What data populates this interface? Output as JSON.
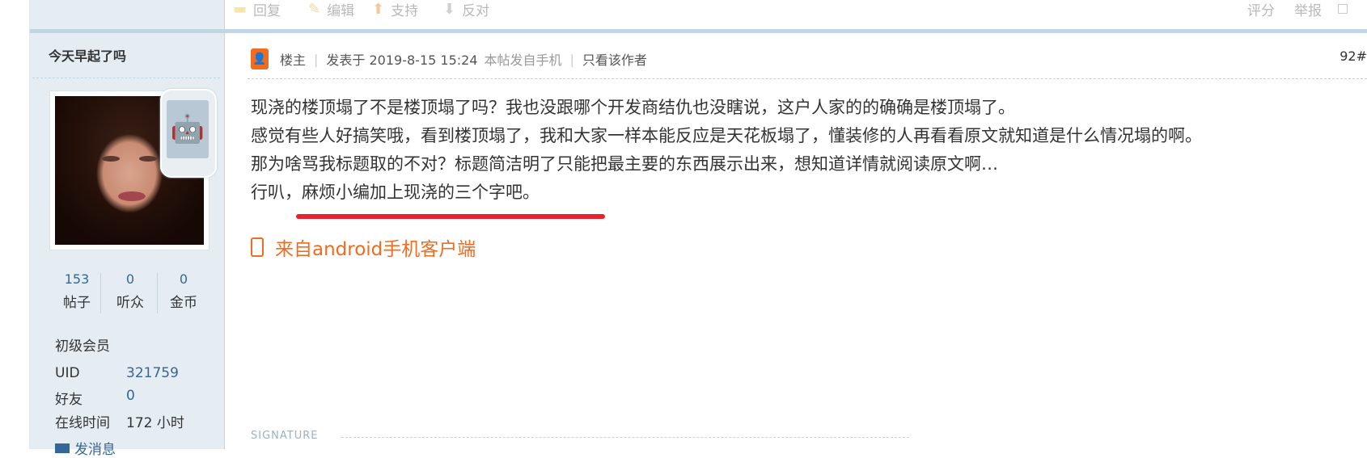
{
  "toolbar": {
    "reply": "回复",
    "edit": "编辑",
    "support": "支持",
    "oppose": "反对",
    "rate": "评分",
    "report": "举报"
  },
  "author": {
    "name": "今天早起了吗",
    "stats": [
      {
        "value": "153",
        "label": "帖子"
      },
      {
        "value": "0",
        "label": "听众"
      },
      {
        "value": "0",
        "label": "金币"
      }
    ],
    "rank": "初级会员",
    "fields": [
      {
        "key": "UID",
        "value": "321759"
      },
      {
        "key": "好友",
        "value": "0"
      },
      {
        "key": "在线时间",
        "value": "172 小时"
      }
    ],
    "send_message": "发消息"
  },
  "post": {
    "owner_label": "楼主",
    "posted_at": "发表于 2019-8-15 15:24",
    "source_note": "本帖发自手机",
    "only_author": "只看该作者",
    "floor_number": "92#",
    "lines": [
      "现浇的楼顶塌了不是楼顶塌了吗？我也没跟哪个开发商结仇也没瞎说，这户人家的的确确是楼顶塌了。",
      "感觉有些人好搞笑哦，看到楼顶塌了，我和大家一样本能反应是天花板塌了，懂装修的人再看看原文就知道是什么情况塌的啊。",
      "那为啥骂我标题取的不对？标题简洁明了只能把最主要的东西展示出来，想知道详情就阅读原文啊…",
      "行叭，麻烦小编加上现浇的三个字吧。"
    ],
    "client_source": "来自android手机客户端",
    "signature_label": "SIGNATURE"
  },
  "colors": {
    "sidebar_bg": "#e5edf2",
    "link": "#336699",
    "accent_orange": "#f26c1f",
    "highlight_red": "#e8222e"
  }
}
